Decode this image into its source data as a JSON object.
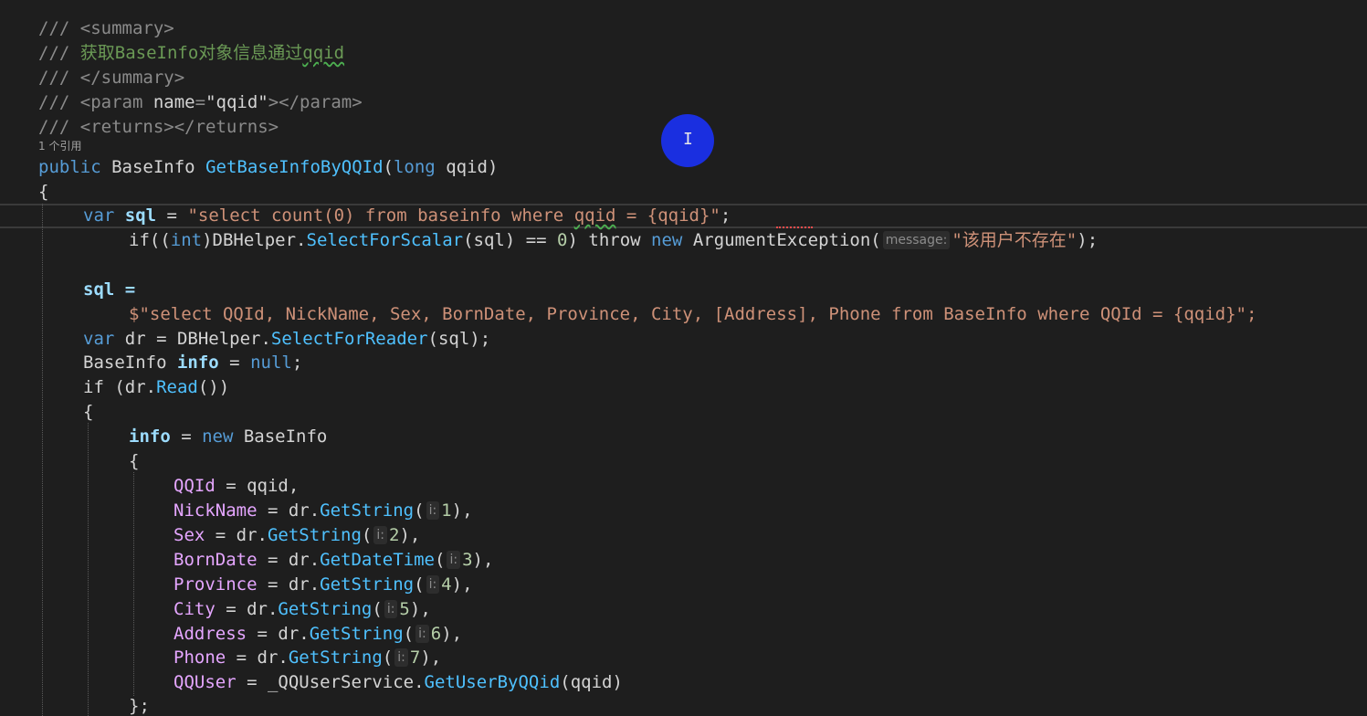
{
  "editor": {
    "doc_comment": {
      "l1_tag": "/// <summary>",
      "l2_prefix": "/// ",
      "l2_text": "获取BaseInfo对象信息通过",
      "l2_squiggle": "qqid",
      "l3_tag": "/// </summary>",
      "l4_a": "/// <param ",
      "l4_name": "name",
      "l4_eq": "=",
      "l4_val": "\"qqid\"",
      "l4_b": "></param>",
      "l5_tag": "/// <returns></returns>"
    },
    "codelens": "1 个引用",
    "method_sig": {
      "kw_public": "public",
      "type": "BaseInfo",
      "name": "GetBaseInfoByQQId",
      "open": "(",
      "kw_long": "long",
      "param": "qqid",
      "close": ")"
    },
    "brace_open": "{",
    "line_var_sql": {
      "kw": "var",
      "name": "sql",
      "eq": " = ",
      "str": "\"select count(0) from baseinfo where ",
      "str_sq": "qqid",
      "str_end": " = {qqid}\"",
      "semi": ";"
    },
    "line_if": {
      "kw_if": "if",
      "p1": "((",
      "kw_int": "int",
      "p2": ")DBHelper.",
      "method": "SelectForScalar",
      "p3": "(sql) == ",
      "zero": "0",
      "p4": ") ",
      "kw_throw": "throw",
      "sp": " ",
      "kw_new": "new",
      "exc": " ArgumentException(",
      "hint": "message:",
      "str": "\"该用户不存在\"",
      "end": ");"
    },
    "line_sql_assign": "sql =",
    "line_sql_str": "$\"select QQId, NickName, Sex, BornDate, Province, City, [Address], Phone from BaseInfo where QQId = {qqid}\";",
    "line_var_dr": {
      "kw": "var",
      "a": " dr = DBHelper.",
      "method": "SelectForReader",
      "b": "(sql);"
    },
    "line_info_decl": {
      "type": "BaseInfo",
      "name": "info",
      "eq": " = ",
      "kw_null": "null",
      "semi": ";"
    },
    "line_if_read": {
      "kw": "if",
      "a": " (dr.",
      "method": "Read",
      "b": "())"
    },
    "brace2": "{",
    "line_info_new": {
      "name": "info",
      "eq": " = ",
      "kw_new": "new",
      "type": " BaseInfo"
    },
    "brace3": "{",
    "assignments": [
      {
        "prop": "QQId",
        "rest": " = qqid,"
      },
      {
        "prop": "NickName",
        "a": " = dr.",
        "method": "GetString",
        "hint": "i:",
        "num": "1",
        "end": "),"
      },
      {
        "prop": "Sex",
        "a": " = dr.",
        "method": "GetString",
        "hint": "i:",
        "num": "2",
        "end": "),"
      },
      {
        "prop": "BornDate",
        "a": " = dr.",
        "method": "GetDateTime",
        "hint": "i:",
        "num": "3",
        "end": "),"
      },
      {
        "prop": "Province",
        "a": " = dr.",
        "method": "GetString",
        "hint": "i:",
        "num": "4",
        "end": "),"
      },
      {
        "prop": "City",
        "a": " = dr.",
        "method": "GetString",
        "hint": "i:",
        "num": "5",
        "end": "),"
      },
      {
        "prop": "Address",
        "a": " = dr.",
        "method": "GetString",
        "hint": "i:",
        "num": "6",
        "end": "),"
      },
      {
        "prop": "Phone",
        "a": " = dr.",
        "method": "GetString",
        "hint": "i:",
        "num": "7",
        "end": "),"
      }
    ],
    "line_qquser": {
      "prop": "QQUser",
      "a": " = _QQUserService.",
      "method": "GetUserByQQid",
      "b": "(qqid)"
    },
    "brace_close": "};"
  },
  "cursor": {
    "glyph": "I"
  }
}
